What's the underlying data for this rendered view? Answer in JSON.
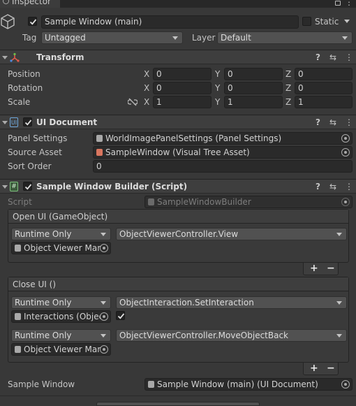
{
  "tab": {
    "title": "Inspector"
  },
  "header": {
    "name": "Sample Window (main)",
    "static_label": "Static",
    "tag_label": "Tag",
    "tag_value": "Untagged",
    "layer_label": "Layer",
    "layer_value": "Default"
  },
  "transform": {
    "title": "Transform",
    "rows": [
      {
        "label": "Position",
        "x": "0",
        "y": "0",
        "z": "0"
      },
      {
        "label": "Rotation",
        "x": "0",
        "y": "0",
        "z": "0"
      },
      {
        "label": "Scale",
        "x": "1",
        "y": "1",
        "z": "1"
      }
    ],
    "axes": {
      "x": "X",
      "y": "Y",
      "z": "Z"
    }
  },
  "uidoc": {
    "title": "UI Document",
    "panel_settings_label": "Panel Settings",
    "panel_settings_value": "WorldImagePanelSettings (Panel Settings)",
    "source_asset_label": "Source Asset",
    "source_asset_value": "SampleWindow (Visual Tree Asset)",
    "sort_order_label": "Sort Order",
    "sort_order_value": "0"
  },
  "script": {
    "title": "Sample Window Builder (Script)",
    "script_label": "Script",
    "script_value": "SampleWindowBuilder",
    "open_ui": {
      "title": "Open UI (GameObject)",
      "mode": "Runtime Only",
      "function": "ObjectViewerController.View",
      "object": "Object Viewer Mana"
    },
    "close_ui": {
      "title": "Close UI ()",
      "entries": [
        {
          "mode": "Runtime Only",
          "function": "ObjectInteraction.SetInteraction",
          "object": "Interactions (Object"
        },
        {
          "mode": "Runtime Only",
          "function": "ObjectViewerController.MoveObjectBack",
          "object": "Object Viewer Mana"
        }
      ]
    },
    "sample_window_label": "Sample Window",
    "sample_window_value": "Sample Window (main) (UI Document)"
  },
  "buttons": {
    "plus": "+",
    "minus": "−"
  },
  "icons": {
    "help": "?",
    "preset": "⇆",
    "menu": "⋮"
  }
}
